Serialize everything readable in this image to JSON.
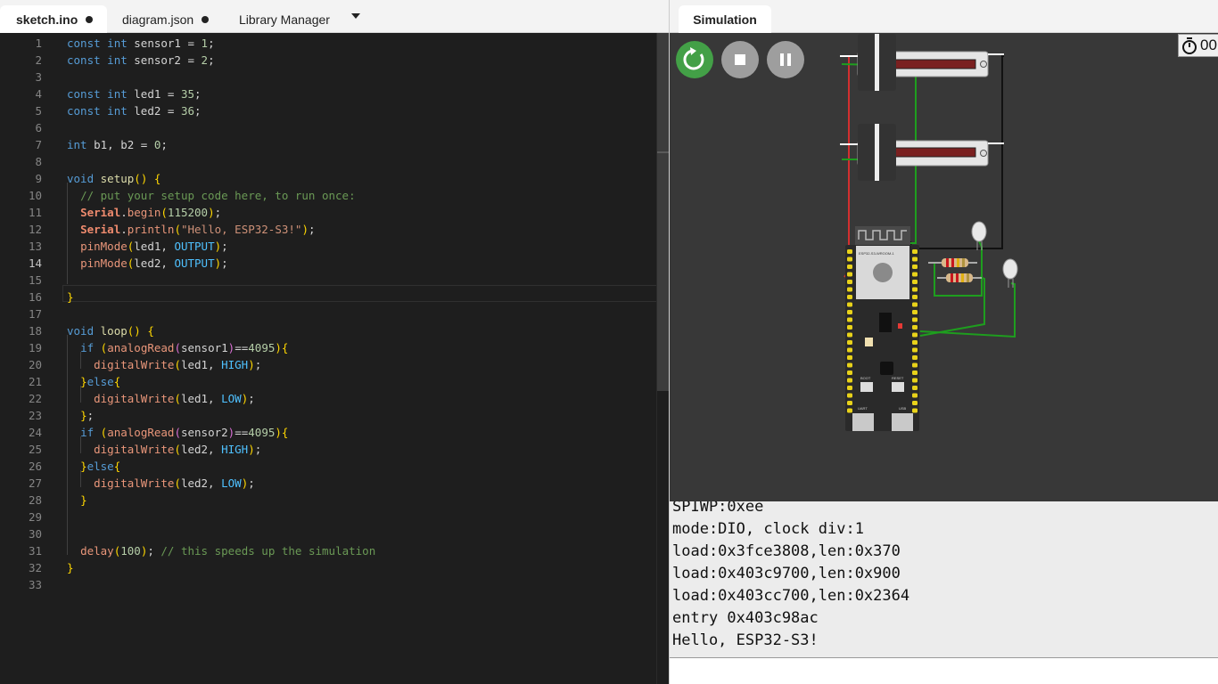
{
  "editor": {
    "tabs": [
      {
        "label": "sketch.ino",
        "unsaved": true
      },
      {
        "label": "diagram.json",
        "unsaved": true
      },
      {
        "label": "Library Manager"
      }
    ],
    "current_line": 14,
    "lines": [
      "const int sensor1 = 1;",
      "const int sensor2 = 2;",
      "",
      "const int led1 = 35;",
      "const int led2 = 36;",
      "",
      "int b1, b2 = 0;",
      "",
      "void setup() {",
      "  // put your setup code here, to run once:",
      "  Serial.begin(115200);",
      "  Serial.println(\"Hello, ESP32-S3!\");",
      "  pinMode(led1, OUTPUT);",
      "  pinMode(led2, OUTPUT);",
      "",
      "}",
      "",
      "void loop() {",
      "  if (analogRead(sensor1)==4095){",
      "    digitalWrite(led1, HIGH);",
      "  }else{",
      "    digitalWrite(led1, LOW);",
      "  };",
      "  if (analogRead(sensor2)==4095){",
      "    digitalWrite(led2, HIGH);",
      "  }else{",
      "    digitalWrite(led2, LOW);",
      "  }",
      "",
      "",
      "  delay(100); // this speeds up the simulation",
      "}",
      ""
    ]
  },
  "simulation": {
    "tab_label": "Simulation",
    "controls": {
      "restart": "restart-icon",
      "stop": "stop-icon",
      "pause": "pause-icon"
    },
    "timer_text": "00",
    "board_label": "ESP32-S3-WROOM-1",
    "board_buttons": [
      "BOOT",
      "RESET"
    ],
    "board_ports": [
      "UART",
      "USB"
    ],
    "colors": {
      "restart": "#43a047",
      "wire_red": "#d32f2f",
      "wire_green": "#1e9e1e",
      "wire_black": "#111111"
    }
  },
  "serial_monitor": {
    "lines": [
      "SPIWP:0xee",
      "mode:DIO, clock div:1",
      "load:0x3fce3808,len:0x370",
      "load:0x403c9700,len:0x900",
      "load:0x403cc700,len:0x2364",
      "entry 0x403c98ac",
      "Hello, ESP32-S3!"
    ]
  }
}
